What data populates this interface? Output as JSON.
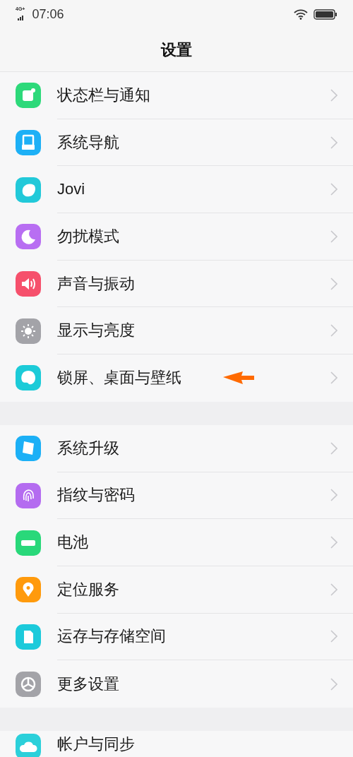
{
  "status_bar": {
    "network": "4G+",
    "time": "07:06"
  },
  "title": "设置",
  "groups": [
    [
      {
        "label": "状态栏与通知",
        "color": "#2dd97a",
        "pointer": false
      },
      {
        "label": "系统导航",
        "color": "#1db0f6",
        "pointer": false
      },
      {
        "label": "Jovi",
        "color": "#22c9d9",
        "pointer": false
      },
      {
        "label": "勿扰模式",
        "color": "#b86ef2",
        "pointer": false
      },
      {
        "label": "声音与振动",
        "color": "#f6506c",
        "pointer": false
      },
      {
        "label": "显示与亮度",
        "color": "#a3a3a8",
        "pointer": false
      },
      {
        "label": "锁屏、桌面与壁纸",
        "color": "#1ccbd8",
        "pointer": true
      }
    ],
    [
      {
        "label": "系统升级",
        "color": "#1cb0f6",
        "pointer": false
      },
      {
        "label": "指纹与密码",
        "color": "#b46cf0",
        "pointer": false
      },
      {
        "label": "电池",
        "color": "#29d87a",
        "pointer": false
      },
      {
        "label": "定位服务",
        "color": "#ff9a0c",
        "pointer": false
      },
      {
        "label": "运存与存储空间",
        "color": "#1ccadb",
        "pointer": false
      },
      {
        "label": "更多设置",
        "color": "#a3a3a8",
        "pointer": false
      }
    ],
    [
      {
        "label": "帐户与同步",
        "color": "#2bd0da",
        "pointer": false
      }
    ]
  ]
}
